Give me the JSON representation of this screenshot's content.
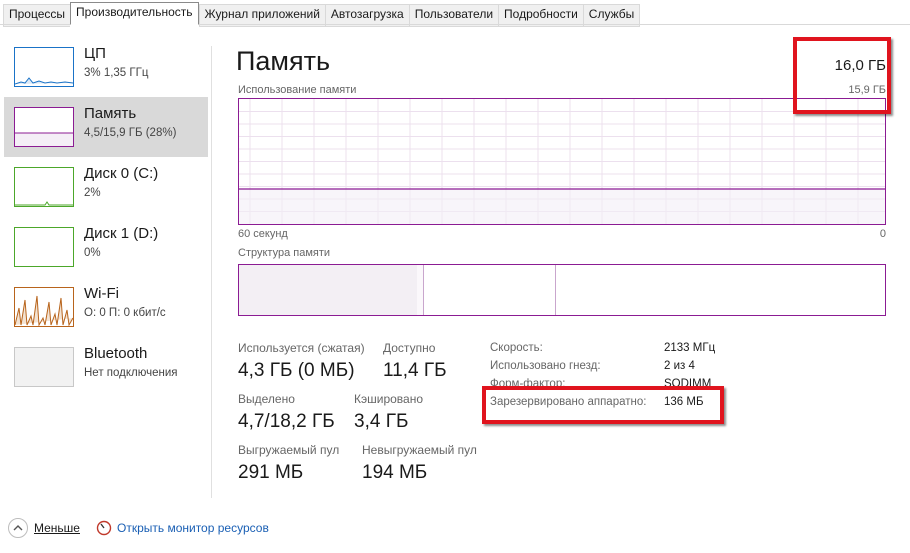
{
  "tabs": [
    {
      "label": "Процессы"
    },
    {
      "label": "Производительность"
    },
    {
      "label": "Журнал приложений"
    },
    {
      "label": "Автозагрузка"
    },
    {
      "label": "Пользователи"
    },
    {
      "label": "Подробности"
    },
    {
      "label": "Службы"
    }
  ],
  "sidebar": {
    "items": [
      {
        "title": "ЦП",
        "sub": "3% 1,35 ГГц",
        "color": "#1a73c7"
      },
      {
        "title": "Память",
        "sub": "4,5/15,9 ГБ (28%)",
        "color": "#8b1b93"
      },
      {
        "title": "Диск 0 (C:)",
        "sub": "2%",
        "color": "#4ca72a"
      },
      {
        "title": "Диск 1 (D:)",
        "sub": "0%",
        "color": "#4ca72a"
      },
      {
        "title": "Wi-Fi",
        "sub": "О: 0 П: 0 кбит/с",
        "color": "#b8641c"
      },
      {
        "title": "Bluetooth",
        "sub": "Нет подключения",
        "color": "#999999"
      }
    ]
  },
  "main": {
    "title": "Память",
    "total": "16,0 ГБ",
    "graph_label": "Использование памяти",
    "graph_max": "15,9 ГБ",
    "time_left": "60 секунд",
    "time_right": "0",
    "struct_label": "Структура памяти",
    "usage_fraction": 0.28,
    "stats": {
      "in_use_label": "Используется (сжатая)",
      "in_use": "4,3 ГБ (0 МБ)",
      "available_label": "Доступно",
      "available": "11,4 ГБ",
      "committed_label": "Выделено",
      "committed": "4,7/18,2 ГБ",
      "cached_label": "Кэшировано",
      "cached": "3,4 ГБ",
      "paged_label": "Выгружаемый пул",
      "paged": "291 МБ",
      "nonpaged_label": "Невыгружаемый пул",
      "nonpaged": "194 МБ"
    },
    "details": {
      "speed_label": "Скорость:",
      "speed": "2133 МГц",
      "slots_label": "Использовано гнезд:",
      "slots": "2 из 4",
      "form_label": "Форм-фактор:",
      "form": "SODIMM",
      "reserved_label": "Зарезервировано аппаратно:",
      "reserved": "136 МБ"
    }
  },
  "footer": {
    "less_label": "Меньше",
    "monitor_label": "Открыть монитор ресурсов"
  },
  "colors": {
    "accent": "#8b1b93",
    "highlight": "#e0141e",
    "link": "#1a5fb4"
  }
}
